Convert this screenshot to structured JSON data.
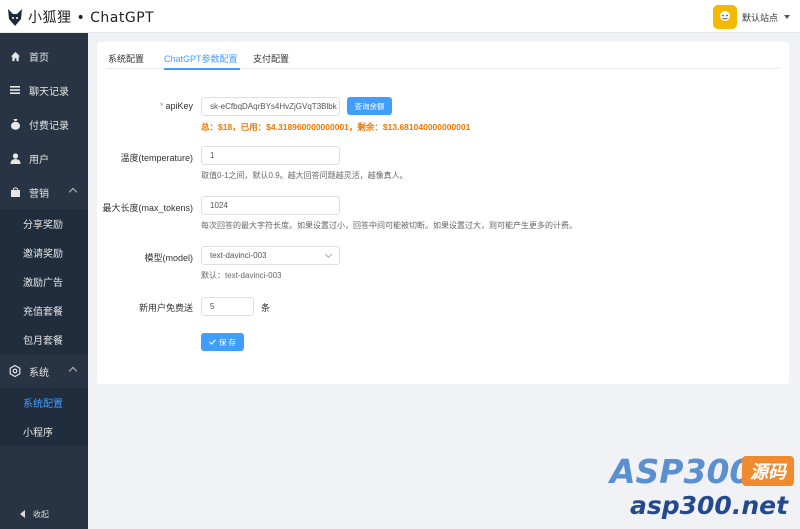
{
  "header": {
    "logo_text": "小狐狸 • ChatGPT",
    "user_name": "默认站点"
  },
  "sidebar": {
    "items": [
      {
        "label": "首页",
        "icon": "home-icon"
      },
      {
        "label": "聊天记录",
        "icon": "list-icon"
      },
      {
        "label": "付费记录",
        "icon": "money-bag-icon"
      },
      {
        "label": "用户",
        "icon": "user-icon"
      },
      {
        "label": "营销",
        "icon": "shop-icon"
      }
    ],
    "marketing_sub": [
      "分享奖励",
      "邀请奖励",
      "激励广告",
      "充值套餐",
      "包月套餐"
    ],
    "system_label": "系统",
    "system_sub": [
      "系统配置",
      "小程序"
    ],
    "collapse_label": "收起"
  },
  "tabs": [
    "系统配置",
    "ChatGPT参数配置",
    "支付配置"
  ],
  "form": {
    "apikey_label": "apiKey",
    "apikey_value": "sk-eCfbqDAqrBYs4HvZjGVqT3Blbk",
    "query_button": "查询余额",
    "balance_text": "总：$18，已用：$4.318960000000001，剩余：$13.681040000000001",
    "temperature_label": "温度(temperature)",
    "temperature_value": "1",
    "temperature_hint": "取值0-1之间，默认0.9。越大回答问题越灵活，越像真人。",
    "max_tokens_label": "最大长度(max_tokens)",
    "max_tokens_value": "1024",
    "max_tokens_hint": "每次回答的最大字符长度。如果设置过小，回答中间可能被切断。如果设置过大，则可能产生更多的计费。",
    "model_label": "模型(model)",
    "model_value": "text-davinci-003",
    "model_hint": "默认：text-davinci-003",
    "free_label": "新用户免费送",
    "free_value": "5",
    "free_unit": "条",
    "save_button": "保 存"
  },
  "watermark": {
    "line1": "ASP300",
    "tag": "源码",
    "line2": "asp300.net"
  },
  "colors": {
    "accent": "#409eff",
    "sidebar_bg": "#283443",
    "balance": "#f07800"
  }
}
